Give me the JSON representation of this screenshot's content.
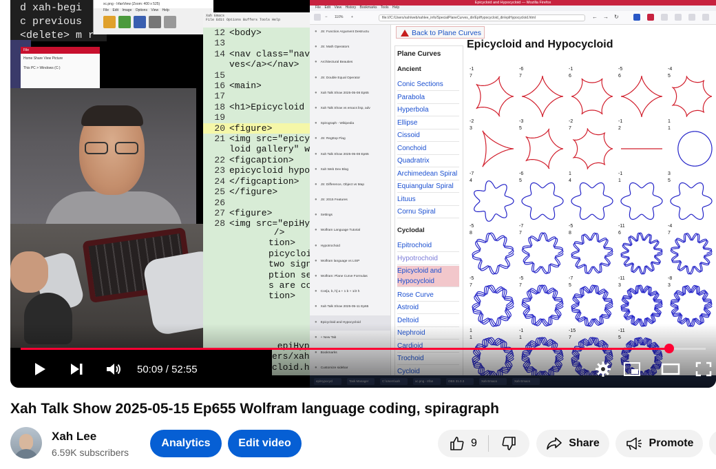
{
  "video_frame": {
    "emacs_terminal_lines": [
      "d     xah-begi",
      "c     previous",
      "<delete> m r"
    ],
    "irfan_title": "xc.png - IrfanView (Zoom: 400 x 525)",
    "irfan_menu": "File  Edit  Image  Options  View  Help",
    "explorer_tab": "File",
    "explorer_ribbon": "Home   Share   View   Picture",
    "explorer_path": "This PC > Windows (C:)",
    "code_editor": {
      "title": "Xah Emacs",
      "menu": "File Edit Options Buffers Tools Help",
      "lines": [
        {
          "n": "12",
          "t": "<body>"
        },
        {
          "n": "13",
          "t": ""
        },
        {
          "n": "14",
          "t": "<nav class=\"navBa"
        },
        {
          "n": "",
          "t": "ves</a></nav>"
        },
        {
          "n": "15",
          "t": ""
        },
        {
          "n": "16",
          "t": "<main>"
        },
        {
          "n": "17",
          "t": ""
        },
        {
          "n": "18",
          "t": "<h1>Epicycloid an"
        },
        {
          "n": "19",
          "t": ""
        },
        {
          "n": "20",
          "t": "<figure>"
        },
        {
          "n": "21",
          "t": "<img src=\"epicycl"
        },
        {
          "n": "",
          "t": "loid gallery\" wid"
        },
        {
          "n": "22",
          "t": "<figcaption>"
        },
        {
          "n": "23",
          "t": "epicycloid hypocy"
        },
        {
          "n": "24",
          "t": "</figcaption>"
        },
        {
          "n": "25",
          "t": "</figure>"
        },
        {
          "n": "26",
          "t": ""
        },
        {
          "n": "27",
          "t": "<figure>"
        },
        {
          "n": "28",
          "t": "<img src=\"epiHypo"
        }
      ],
      "partial_lines": [
        " />",
        "tion>",
        "picycloid a",
        "two signed",
        "ption sect",
        "s are colo",
        "tion>",
        "",
        "",
        "ref=\"../mm"
      ],
      "bottom_lines": [
        "_epiHypocy",
        "ers/xah/web",
        "cloid.html"
      ]
    },
    "browser": {
      "title": "Epicycloid and Hypocycloid — Mozilla Firefox",
      "menu": "File  Edit  View  History  Bookmarks  Tools  Help",
      "zoom": "110%",
      "url": "file:///C:/Users/xah/web/xahlee_info/SpecialPlaneCurves_dir/EpiHypocycloid_dir/epiHypocycloid.html",
      "tabs": [
        "JS: Function Argument Destructu",
        "JS: Math Operators",
        "Architectural Beauties",
        "JS: Double Equal Operator",
        "Xah Talk Show 2025-05-08 Ep65",
        "Xah Talk Show vs emacs lisp, adv",
        "Spirograph - Wikipedia",
        "JS: RegExp Flag",
        "Xah Talk Show 2025-05-08 Ep65",
        "Xah Web Dev Blog",
        "JS: Difference, Object vs Map",
        "JS: 2015 Features",
        "Settings",
        "Wolfram Language Tutorial",
        "Hypotrochoid",
        "Wolfram language vs LISP",
        "Wolfram: Plane Curve Formulas",
        "Cos[a, b, h] a + 1 b + 1/2 h",
        "Xah Talk Show 2025-05-11 Ep65",
        "Epicycloid and Hypocycloid",
        "+ New Tab",
        "Bookmarks",
        "Customize sidebar"
      ],
      "back_link": "Back to Plane Curves",
      "sidebar_title": "Plane Curves",
      "sidebar": {
        "cat_ancient": "Ancient",
        "ancient": [
          "Conic Sections",
          "Parabola",
          "Hyperbola",
          "Ellipse",
          "Cissoid",
          "Conchoid",
          "Quadratrix",
          "Archimedean Spiral",
          "Equiangular Spiral",
          "Lituus",
          "Cornu Spiral"
        ],
        "cat_cycloidal": "Cyclodal",
        "cycloidal": [
          "Epitrochoid",
          "Hypotrochoid",
          "Epicycloid and Hypocycloid",
          "Rose Curve",
          "Astroid",
          "Deltoid",
          "Nephroid",
          "Cardioid",
          "Trochoid",
          "Cycloid"
        ]
      },
      "heading": "Epicycloid and Hypocycloid",
      "curve_labels": [
        [
          "-1 | 7",
          "-6 | 7",
          "-1 | 6",
          "-5 | 6",
          "-4 | 5",
          "-1 | 5",
          "-3 | 4"
        ],
        [
          "-2 | 3",
          "-3 | 5",
          "-2 | 7",
          "-1 | 2",
          "1 | 1",
          "1 | 8"
        ],
        [
          "-7 | 4",
          "-6 | 5",
          "1 | 4",
          "-1 | 1",
          "3 | 5",
          "4 | 1"
        ],
        [
          "-5 | 8",
          "-7 | 7",
          "-5 | 8",
          "-11 | 6",
          "-4 | 7"
        ],
        [
          "-5 | 7",
          "-5 | 7",
          "-7 | 5",
          "-11 | 3",
          "-8 | 3"
        ],
        [
          "1 | 1",
          "-1 | 1",
          "-15 | 7",
          "-11 | 5"
        ]
      ]
    },
    "taskbar": [
      "epiHypocycl",
      "Task Manager",
      "C:\\Users\\xah",
      "xc.png - Irfan",
      "OBS 31.0.3",
      "Xah Emacs",
      "Xah Emacs"
    ]
  },
  "player": {
    "time_current": "50:09",
    "time_total": "52:55",
    "progress_fraction": 0.947
  },
  "video": {
    "title": "Xah Talk Show 2025-05-15 Ep655 Wolfram language coding, spiragraph",
    "channel_name": "Xah Lee",
    "subscribers": "6.59K subscribers",
    "analytics_label": "Analytics",
    "edit_label": "Edit video",
    "like_count": "9",
    "share_label": "Share",
    "promote_label": "Promote"
  },
  "colors": {
    "accent_red": "#ff0033",
    "button_blue": "#065fd4",
    "firefox_title": "#c7223f",
    "curve_red": "#d11d2b",
    "curve_blue": "#2424c8"
  }
}
